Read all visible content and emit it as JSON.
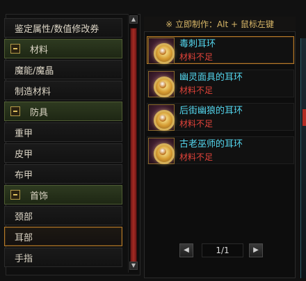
{
  "left_panel": {
    "categories": [
      {
        "label": "鉴定属性/数值修改券",
        "kind": "item"
      },
      {
        "label": "材料",
        "kind": "group"
      },
      {
        "label": "魔能/魔晶",
        "kind": "item"
      },
      {
        "label": "制造材料",
        "kind": "item"
      },
      {
        "label": "防具",
        "kind": "group"
      },
      {
        "label": "重甲",
        "kind": "item"
      },
      {
        "label": "皮甲",
        "kind": "item"
      },
      {
        "label": "布甲",
        "kind": "item"
      },
      {
        "label": "首饰",
        "kind": "group"
      },
      {
        "label": "颈部",
        "kind": "item"
      },
      {
        "label": "耳部",
        "kind": "item",
        "selected": true
      },
      {
        "label": "手指",
        "kind": "item"
      }
    ],
    "scroll": {
      "up_icon": "up-arrow-icon",
      "down_icon": "down-arrow-icon"
    }
  },
  "right_panel": {
    "hint": "※ 立即制作：Alt + 鼠标左键",
    "items": [
      {
        "name": "毒刺耳环",
        "status": "材料不足",
        "selected": true
      },
      {
        "name": "幽灵面具的耳环",
        "status": "材料不足"
      },
      {
        "name": "后街幽狼的耳环",
        "status": "材料不足"
      },
      {
        "name": "古老巫师的耳环",
        "status": "材料不足"
      }
    ],
    "pager": {
      "page": "1/1",
      "prev_icon": "left-arrow-icon",
      "next_icon": "right-arrow-icon"
    }
  },
  "colors": {
    "item_name": "#54d6ee",
    "status_red": "#e2433a",
    "group_green": "#2e3a20",
    "selected_border": "#b57a2a",
    "hint_gold": "#d8b768",
    "scroll_red": "#a52a22"
  }
}
